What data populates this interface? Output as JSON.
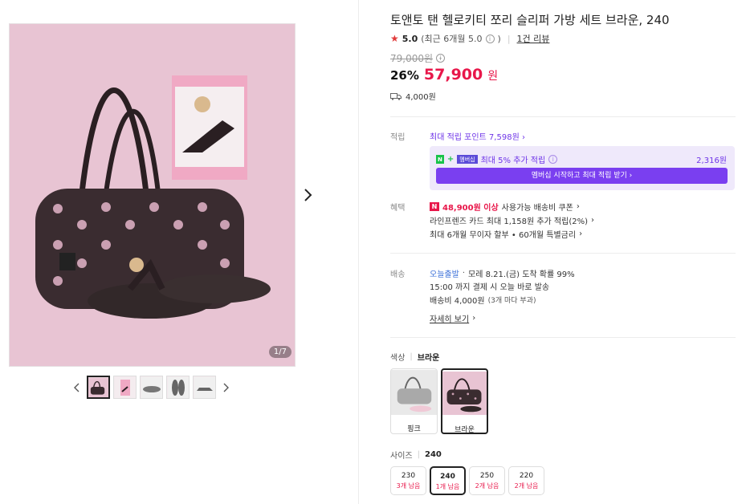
{
  "gallery": {
    "counter": "1/7",
    "thumbnails": [
      "bag-and-slippers",
      "keyring-card",
      "slipper-side",
      "slippers-top",
      "slipper-profile"
    ]
  },
  "product": {
    "title": "토앤토 탠 헬로키티 쪼리 슬리퍼 가방 세트 브라운, 240",
    "rating": "5.0",
    "rating_recent": "(최근 6개월 5.0",
    "rating_recent_close": ")",
    "review_link": "1건 리뷰",
    "original_price": "79,000원",
    "discount": "26%",
    "sale_price": "57,900",
    "currency": "원",
    "shipping_fee": "4,000원"
  },
  "points": {
    "label": "적립",
    "max_points": "최대 적립 포인트 7,598원",
    "membership_extra": "최대 5% 추가 적립",
    "membership_badge_n": "N",
    "membership_badge_m": "멤버십",
    "membership_amount": "2,316원",
    "membership_button": "멤버십 시작하고 최대 적립 받기"
  },
  "benefits": {
    "label": "혜택",
    "coupon_badge": "N",
    "coupon_amount": "48,900원 이상",
    "coupon_text": "사용가능 배송비 쿠폰",
    "card_text": "라인프렌즈 카드 최대 1,158원 추가 적립(2%)",
    "installment_text": "최대 6개월 무이자 할부 • 60개월 특별금리"
  },
  "delivery": {
    "label": "배송",
    "today": "오늘출발",
    "arrival": "모레 8.21.(금) 도착 확률 99%",
    "cutoff": "15:00 까지 결제 시 오늘 바로 발송",
    "fee": "배송비 4,000원",
    "fee_note": "(3개 마다 부과)",
    "details_link": "자세히 보기"
  },
  "color": {
    "label": "색상",
    "selected": "브라운",
    "options": [
      {
        "name": "핑크"
      },
      {
        "name": "브라운"
      }
    ]
  },
  "size": {
    "label": "사이즈",
    "selected": "240",
    "options": [
      {
        "value": "230",
        "stock": "3개 남음"
      },
      {
        "value": "240",
        "stock": "1개 남음"
      },
      {
        "value": "250",
        "stock": "2개 남음"
      },
      {
        "value": "220",
        "stock": "2개 남음"
      }
    ]
  },
  "colors": {
    "sale_red": "#e8174a",
    "membership_purple": "#7a3ff0",
    "image_bg": "#e8c4d3"
  }
}
